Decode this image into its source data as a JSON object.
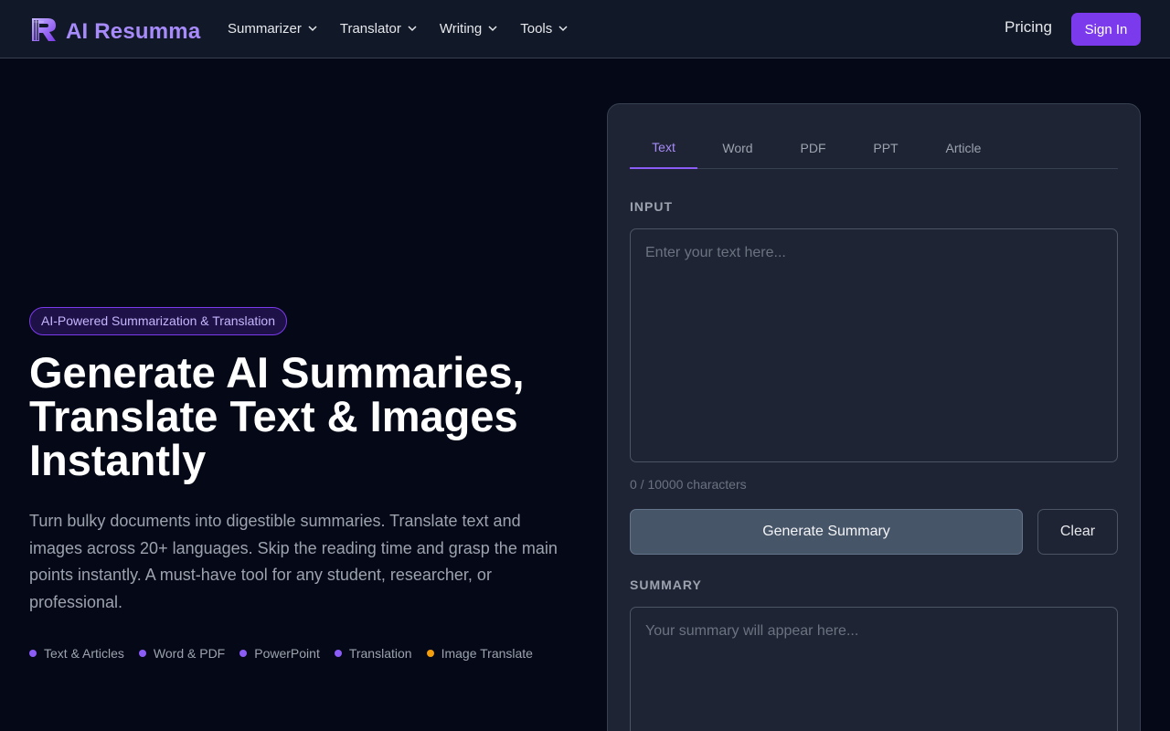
{
  "header": {
    "logo_icon": "resumma-logo-icon",
    "brand": "AI Resumma",
    "nav": [
      {
        "label": "Summarizer",
        "icon": "chevron-down-icon"
      },
      {
        "label": "Translator",
        "icon": "chevron-down-icon"
      },
      {
        "label": "Writing",
        "icon": "chevron-down-icon"
      },
      {
        "label": "Tools",
        "icon": "chevron-down-icon"
      }
    ],
    "pricing": "Pricing",
    "signin": "Sign In"
  },
  "hero": {
    "badge": "AI-Powered Summarization & Translation",
    "title_lines": [
      "Generate AI Summaries,",
      "Translate Text & Images",
      "Instantly"
    ],
    "description": "Turn bulky documents into digestible summaries. Translate text and images across 20+ languages. Skip the reading time and grasp the main points instantly. A must-have tool for any student, researcher, or professional.",
    "features": [
      {
        "label": "Text & Articles",
        "color": "#8b5cf6"
      },
      {
        "label": "Word & PDF",
        "color": "#8b5cf6"
      },
      {
        "label": "PowerPoint",
        "color": "#8b5cf6"
      },
      {
        "label": "Translation",
        "color": "#8b5cf6"
      },
      {
        "label": "Image Translate",
        "color": "#f59e0b"
      }
    ]
  },
  "panel": {
    "tabs": [
      {
        "label": "Text",
        "active": true
      },
      {
        "label": "Word",
        "active": false
      },
      {
        "label": "PDF",
        "active": false
      },
      {
        "label": "PPT",
        "active": false
      },
      {
        "label": "Article",
        "active": false
      }
    ],
    "input_label": "INPUT",
    "input_placeholder": "Enter your text here...",
    "input_value": "",
    "char_count": "0 / 10000 characters",
    "generate_label": "Generate Summary",
    "clear_label": "Clear",
    "summary_label": "SUMMARY",
    "summary_placeholder": "Your summary will appear here..."
  },
  "colors": {
    "accent": "#7c3aed",
    "accent_light": "#a78bfa",
    "background": "#050816",
    "panel": "#1e2433"
  }
}
